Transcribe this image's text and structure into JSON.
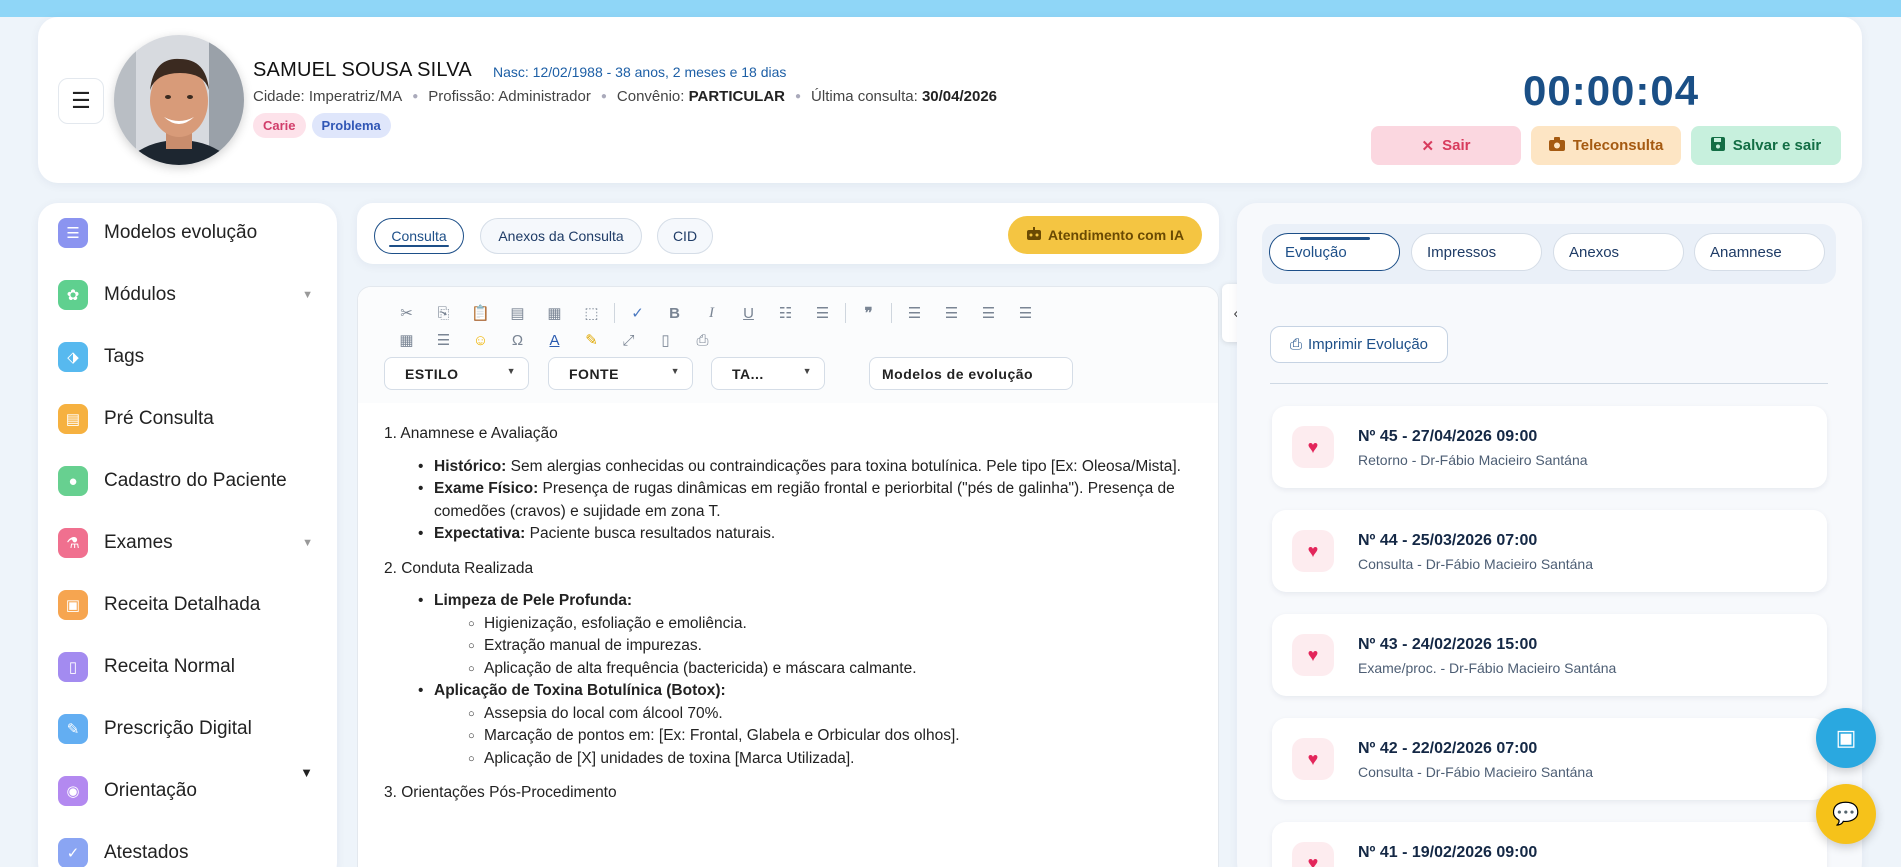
{
  "patient": {
    "name": "SAMUEL SOUSA SILVA",
    "birth": "Nasc: 12/02/1988 - 38 anos, 2 meses e 18 dias",
    "city": "Cidade: Imperatriz/MA",
    "profession": "Profissão: Administrador",
    "convenio_label": "Convênio:",
    "convenio_value": "PARTICULAR",
    "last_label": "Última consulta:",
    "last_value": "30/04/2026",
    "tags": [
      "Carie",
      "Problema"
    ]
  },
  "timer": "00:00:04",
  "header_buttons": {
    "sair": "Sair",
    "tele": "Teleconsulta",
    "salvar": "Salvar e sair"
  },
  "sidebar": {
    "items": [
      {
        "label": "Modelos evolução",
        "icon": "list-icon",
        "color": "#8b94f0"
      },
      {
        "label": "Módulos",
        "icon": "modules-icon",
        "color": "#5fd08f"
      },
      {
        "label": "Tags",
        "icon": "tag-icon",
        "color": "#57b9ef"
      },
      {
        "label": "Pré Consulta",
        "icon": "clipboard-icon",
        "color": "#f6b140"
      },
      {
        "label": "Cadastro do Paciente",
        "icon": "user-icon",
        "color": "#67d090"
      },
      {
        "label": "Exames",
        "icon": "flask-icon",
        "color": "#f0708f"
      },
      {
        "label": "Receita Detalhada",
        "icon": "document-icon",
        "color": "#f6a550"
      },
      {
        "label": "Receita Normal",
        "icon": "document-icon",
        "color": "#a38bf0"
      },
      {
        "label": "Prescrição Digital",
        "icon": "pen-icon",
        "color": "#63aef2"
      },
      {
        "label": "Orientação",
        "icon": "lightbulb-icon",
        "color": "#b389f0"
      },
      {
        "label": "Atestados",
        "icon": "check-icon",
        "color": "#8aa5f3"
      }
    ]
  },
  "center_tabs": {
    "consulta": "Consulta",
    "anexos": "Anexos da Consulta",
    "cid": "CID",
    "ai": "Atendimento com IA"
  },
  "editor": {
    "selects": {
      "estilo": "ESTILO",
      "fonte": "FONTE",
      "tamanho": "TA...",
      "modelos": "Modelos de evolução"
    },
    "sections": {
      "s1": "1. Anamnese e Avaliação",
      "historico_label": "Histórico:",
      "historico_text": " Sem alergias conhecidas ou contraindicações para toxina botulínica. Pele tipo [Ex: Oleosa/Mista].",
      "exame_label": "Exame Físico:",
      "exame_text": " Presença de rugas dinâmicas em região frontal e periorbital (\"pés de galinha\"). Presença de comedões (cravos) e sujidade em zona T.",
      "expect_label": "Expectativa:",
      "expect_text": " Paciente busca resultados naturais.",
      "s2": "2. Conduta Realizada",
      "limpeza_label": "Limpeza de Pele Profunda:",
      "limpeza_items": [
        "Higienização, esfoliação e emoliência.",
        "Extração manual de impurezas.",
        "Aplicação de alta frequência (bactericida) e máscara calmante."
      ],
      "toxina_label": "Aplicação de Toxina Botulínica (Botox):",
      "toxina_items": [
        "Assepsia do local com álcool 70%.",
        "Marcação de pontos em: [Ex: Frontal, Glabela e Orbicular dos olhos].",
        "Aplicação de [X] unidades de toxina [Marca Utilizada]."
      ],
      "s3": "3. Orientações Pós-Procedimento"
    }
  },
  "right_tabs": {
    "evolucao": "Evolução",
    "impressos": "Impressos",
    "anexos": "Anexos",
    "anamnese": "Anamnese"
  },
  "print_button": "Imprimir Evolução",
  "evolutions": [
    {
      "title": "Nº 45 - 27/04/2026 09:00",
      "sub": "Retorno - Dr-Fábio Macieiro Santána"
    },
    {
      "title": "Nº 44 - 25/03/2026 07:00",
      "sub": "Consulta - Dr-Fábio Macieiro Santána"
    },
    {
      "title": "Nº 43 - 24/02/2026 15:00",
      "sub": "Exame/proc. - Dr-Fábio Macieiro Santána"
    },
    {
      "title": "Nº 42 - 22/02/2026 07:00",
      "sub": "Consulta - Dr-Fábio Macieiro Santána"
    },
    {
      "title": "Nº 41 - 19/02/2026 09:00",
      "sub": ""
    }
  ],
  "colors": {
    "accent": "#1d4f88",
    "timer": "#1a4f86",
    "heart": "#e3265b"
  }
}
